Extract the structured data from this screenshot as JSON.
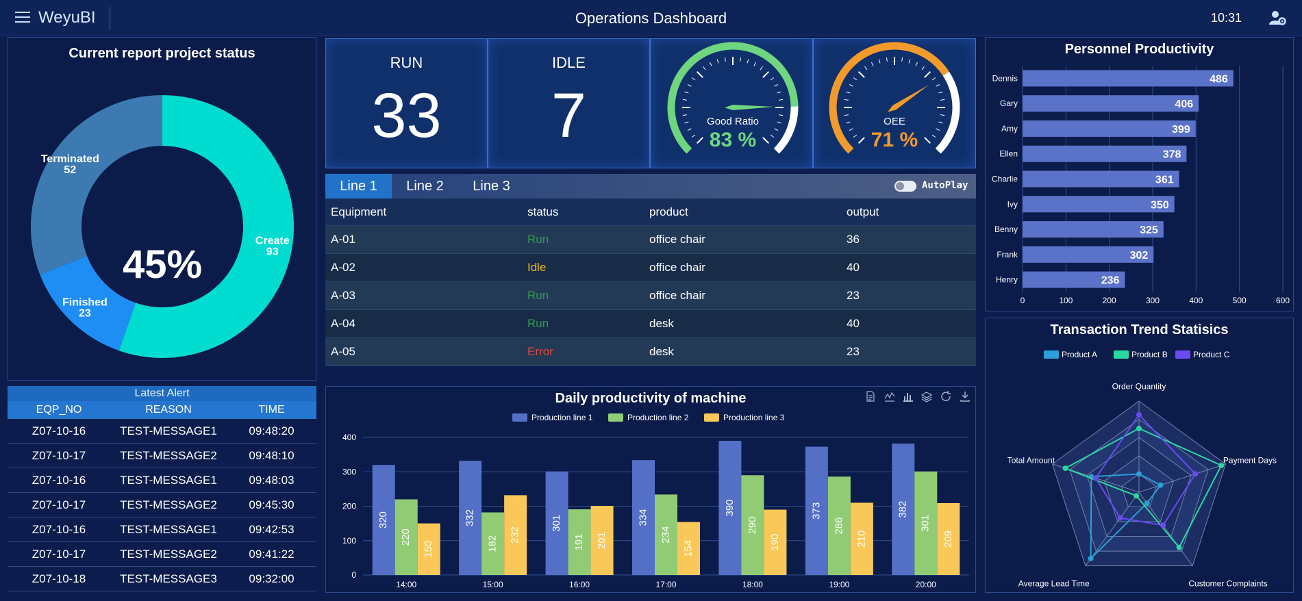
{
  "header": {
    "brand": "WeyuBI",
    "title": "Operations Dashboard",
    "time": "10:31"
  },
  "project_status": {
    "title": "Current report project status",
    "center_label": "45%",
    "chart_data": {
      "type": "pie",
      "categories": [
        "Create",
        "Finished",
        "Terminated"
      ],
      "values": [
        93,
        23,
        52
      ],
      "colors": [
        "#00dccf",
        "#1e8ef5",
        "#3d7ab2"
      ],
      "title": "Current report project status"
    }
  },
  "kpis": {
    "run_label": "RUN",
    "run_value": "33",
    "idle_label": "IDLE",
    "idle_value": "7",
    "good_ratio": {
      "label": "Good Ratio",
      "value_text": "83 %",
      "value": 83,
      "color": "#6fd57f"
    },
    "oee": {
      "label": "OEE",
      "value_text": "71 %",
      "value": 71,
      "color": "#f29b2c"
    }
  },
  "lines": {
    "tabs": [
      "Line 1",
      "Line 2",
      "Line 3"
    ],
    "active_tab": "Line 1",
    "autoplay_label": "AutoPlay",
    "columns": [
      "Equipment",
      "status",
      "product",
      "output"
    ],
    "rows": [
      {
        "equipment": "A-01",
        "status": "Run",
        "product": "office chair",
        "output": "36"
      },
      {
        "equipment": "A-02",
        "status": "Idle",
        "product": "office chair",
        "output": "40"
      },
      {
        "equipment": "A-03",
        "status": "Run",
        "product": "office chair",
        "output": "23"
      },
      {
        "equipment": "A-04",
        "status": "Run",
        "product": "desk",
        "output": "40"
      },
      {
        "equipment": "A-05",
        "status": "Error",
        "product": "desk",
        "output": "23"
      }
    ],
    "status_colors": {
      "Run": "#2e9b4f",
      "Idle": "#f2b92a",
      "Error": "#e0463f"
    }
  },
  "alerts": {
    "title": "Latest Alert",
    "columns": [
      "EQP_NO",
      "REASON",
      "TIME"
    ],
    "rows": [
      {
        "eqp": "Z07-10-16",
        "reason": "TEST-MESSAGE1",
        "time": "09:48:20"
      },
      {
        "eqp": "Z07-10-17",
        "reason": "TEST-MESSAGE2",
        "time": "09:48:10"
      },
      {
        "eqp": "Z07-10-16",
        "reason": "TEST-MESSAGE1",
        "time": "09:48:03"
      },
      {
        "eqp": "Z07-10-17",
        "reason": "TEST-MESSAGE2",
        "time": "09:45:30"
      },
      {
        "eqp": "Z07-10-16",
        "reason": "TEST-MESSAGE1",
        "time": "09:42:53"
      },
      {
        "eqp": "Z07-10-17",
        "reason": "TEST-MESSAGE2",
        "time": "09:41:22"
      },
      {
        "eqp": "Z07-10-18",
        "reason": "TEST-MESSAGE3",
        "time": "09:32:00"
      }
    ]
  },
  "daily": {
    "title": "Daily productivity of machine",
    "toolbox_icons": [
      "data-view-icon",
      "line-chart-icon",
      "bar-chart-icon",
      "stack-icon",
      "restore-icon",
      "download-icon"
    ],
    "chart_data": {
      "type": "bar",
      "title": "Daily productivity of machine",
      "categories": [
        "14:00",
        "15:00",
        "16:00",
        "17:00",
        "18:00",
        "19:00",
        "20:00"
      ],
      "series": [
        {
          "name": "Production line 1",
          "values": [
            320,
            332,
            301,
            334,
            390,
            373,
            382
          ],
          "color": "#5470c6"
        },
        {
          "name": "Production line 2",
          "values": [
            220,
            182,
            191,
            234,
            290,
            286,
            301
          ],
          "color": "#91cc75"
        },
        {
          "name": "Production line 3",
          "values": [
            150,
            232,
            201,
            154,
            190,
            210,
            209
          ],
          "color": "#fac858"
        }
      ],
      "ylim": [
        0,
        400
      ],
      "yticks": [
        0,
        100,
        200,
        300,
        400
      ],
      "grid": true,
      "legend": "top-center"
    }
  },
  "personnel": {
    "title": "Personnel Productivity",
    "chart_data": {
      "type": "bar",
      "orientation": "horizontal",
      "title": "Personnel Productivity",
      "categories": [
        "Dennis",
        "Gary",
        "Amy",
        "Ellen",
        "Charlie",
        "Ivy",
        "Benny",
        "Frank",
        "Henry"
      ],
      "values": [
        486,
        406,
        399,
        378,
        361,
        350,
        325,
        302,
        236
      ],
      "xlim": [
        0,
        600
      ],
      "xticks": [
        0,
        100,
        200,
        300,
        400,
        500,
        600
      ],
      "color": "#5a72c8"
    }
  },
  "trend": {
    "title": "Transaction Trend Statisics",
    "chart_data": {
      "type": "radar",
      "title": "Transaction Trend Statisics",
      "indicators": [
        "Order Quantity",
        "Payment Days",
        "Customer Complaints",
        "Average Lead Time",
        "Total Amount"
      ],
      "series": [
        {
          "name": "Product A",
          "values": [
            0.2,
            0.25,
            0.15,
            0.9,
            0.55
          ],
          "color": "#2b9fd8"
        },
        {
          "name": "Product B",
          "values": [
            0.7,
            0.95,
            0.75,
            0.05,
            0.85
          ],
          "color": "#2bd7a1"
        },
        {
          "name": "Product C",
          "values": [
            0.85,
            0.65,
            0.45,
            0.35,
            0.5
          ],
          "color": "#6a4bf2"
        }
      ],
      "legend": "top-center"
    }
  }
}
